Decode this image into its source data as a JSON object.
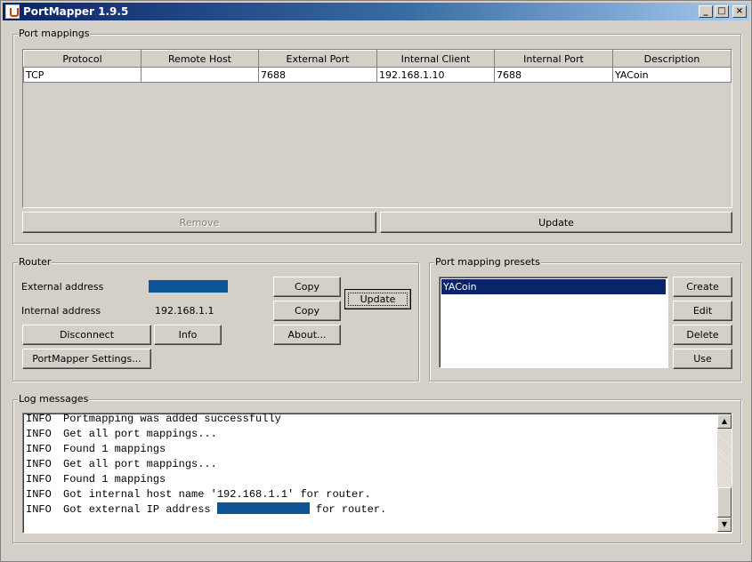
{
  "window": {
    "title": "PortMapper 1.9.5",
    "controls": {
      "minimize": "_",
      "maximize": "□",
      "close": "×"
    }
  },
  "port_mappings": {
    "group_label": "Port mappings",
    "columns": [
      "Protocol",
      "Remote Host",
      "External Port",
      "Internal Client",
      "Internal Port",
      "Description"
    ],
    "rows": [
      [
        "TCP",
        "",
        "7688",
        "192.168.1.10",
        "7688",
        "YACoin"
      ]
    ],
    "remove_label": "Remove",
    "update_label": "Update"
  },
  "router": {
    "group_label": "Router",
    "external_address_label": "External address",
    "internal_address_label": "Internal address",
    "internal_address_value": "192.168.1.1",
    "copy_label": "Copy",
    "update_label": "Update",
    "disconnect_label": "Disconnect",
    "info_label": "Info",
    "about_label": "About...",
    "settings_label": "PortMapper Settings..."
  },
  "presets": {
    "group_label": "Port mapping presets",
    "items": [
      "YACoin"
    ],
    "create_label": "Create",
    "edit_label": "Edit",
    "delete_label": "Delete",
    "use_label": "Use"
  },
  "log": {
    "group_label": "Log messages",
    "lines": [
      {
        "level": "INFO",
        "text": "Portmapping was added successfully"
      },
      {
        "level": "INFO",
        "text": "Get all port mappings..."
      },
      {
        "level": "INFO",
        "text": "Found 1 mappings"
      },
      {
        "level": "INFO",
        "text": "Get all port mappings..."
      },
      {
        "level": "INFO",
        "text": "Found 1 mappings"
      },
      {
        "level": "INFO",
        "text": "Got internal host name '192.168.1.1' for router."
      },
      {
        "level": "INFO",
        "text_before": "Got external IP address ",
        "text_after": " for router."
      }
    ]
  },
  "colors": {
    "title_start": "#0a246a",
    "title_end": "#a6caf0",
    "selection": "#0a246a",
    "redaction": "#0c5597",
    "face": "#d4d0c8"
  }
}
